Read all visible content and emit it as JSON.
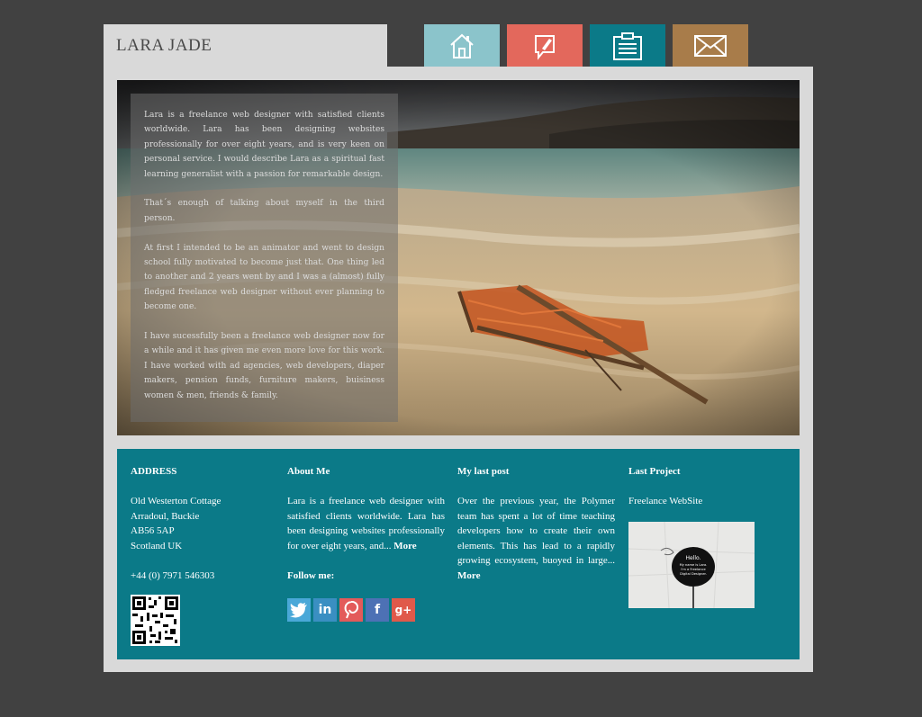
{
  "header": {
    "site_title": "LARA JADE"
  },
  "nav": {
    "items": [
      {
        "name": "home",
        "icon": "home-icon",
        "color": "#8bc4cb"
      },
      {
        "name": "blog",
        "icon": "pen-note-icon",
        "color": "#e3685c"
      },
      {
        "name": "work",
        "icon": "clipboard-icon",
        "color": "#0b7a88"
      },
      {
        "name": "contact",
        "icon": "envelope-icon",
        "color": "#a87c4a"
      }
    ]
  },
  "bio": {
    "paragraphs": [
      "Lara is a freelance web designer with satisfied clients worldwide. Lara has been designing websites professionally for over eight years, and is very keen on personal service. I would describe Lara as a spiritual fast learning generalist with a passion for remarkable design.",
      "That´s enough of talking about myself in the third person.",
      "At first I intended to be an animator and went to design school fully motivated to become just that. One thing led to another and 2 years went by and I was a (almost) fully fledged freelance web designer without ever planning to become one.",
      "I have sucessfully been a freelance web designer now for a while and it has given me even more love for this work. I have worked with ad agencies, web developers, diaper makers, pension funds, furniture makers, buisiness women & men, friends & family."
    ]
  },
  "footer": {
    "address": {
      "heading": "ADDRESS",
      "line1": "Old Westerton Cottage",
      "line2": "Arradoul, Buckie",
      "line3": "AB56 5AP",
      "line4": "Scotland UK",
      "phone": "+44 (0) 7971 546303"
    },
    "about": {
      "heading": "About Me",
      "text": "Lara is a freelance web designer with satisfied clients worldwide. Lara has been designing websites professionally for over eight years, and...",
      "more": "More",
      "follow": "Follow me:"
    },
    "socials": [
      {
        "name": "twitter",
        "glyph": "t",
        "color": "#4aa8d8"
      },
      {
        "name": "linkedin",
        "glyph": "in",
        "color": "#3a8fc2"
      },
      {
        "name": "pinterest",
        "glyph": "P",
        "color": "#e35a5a"
      },
      {
        "name": "facebook",
        "glyph": "f",
        "color": "#4d71b5"
      },
      {
        "name": "googleplus",
        "glyph": "g+",
        "color": "#e0594a"
      }
    ],
    "post": {
      "heading": "My last post",
      "text": "Over the previous year, the Polymer team has spent a lot of time teaching developers how to create their own elements. This has lead to a rapidly growing ecosystem, buoyed in large...",
      "more": "More"
    },
    "project": {
      "heading": "Last Project",
      "title": "Freelance WebSite",
      "thumb_text": "Hello. My name is Lara. I'm a Freelance Digital Designer."
    }
  }
}
